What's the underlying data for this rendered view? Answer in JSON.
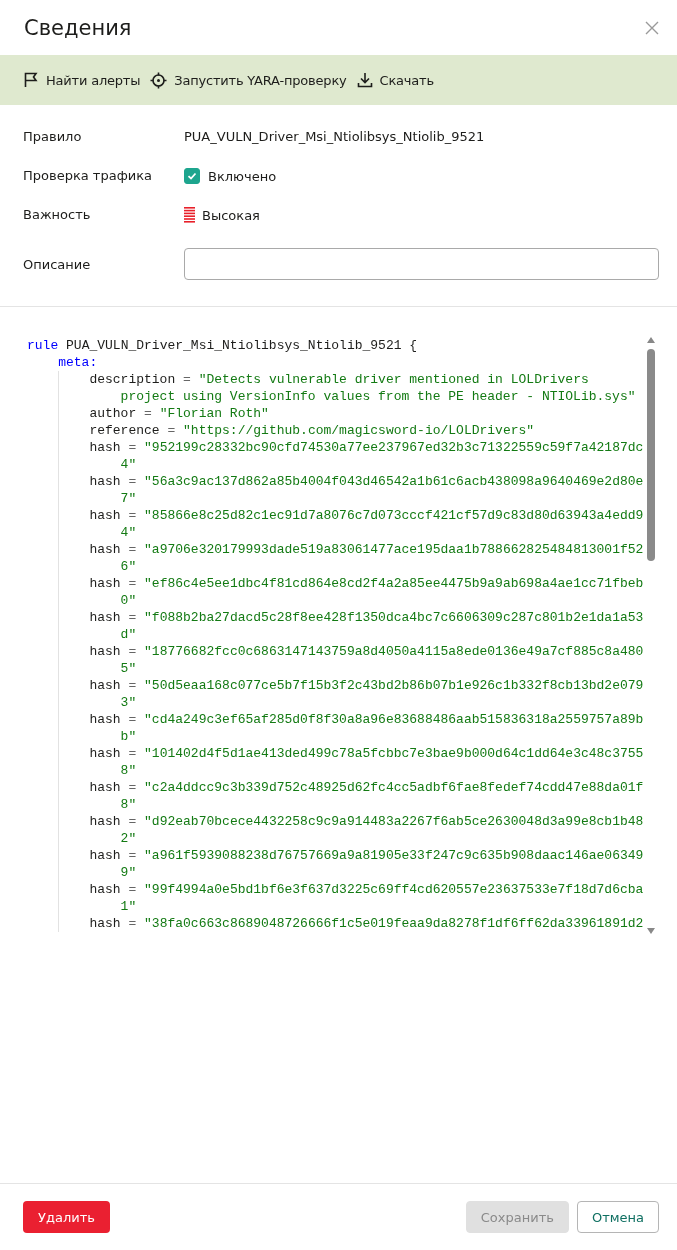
{
  "dialog": {
    "title": "Сведения"
  },
  "toolbar": [
    {
      "kind": "flag",
      "label": "Найти алерты"
    },
    {
      "kind": "target",
      "label": "Запустить YARA-проверку"
    },
    {
      "kind": "download",
      "label": "Скачать"
    }
  ],
  "fields": [
    {
      "kind": "text",
      "label": "Правило",
      "value": "PUA_VULN_Driver_Msi_Ntiolibsys_Ntiolib_9521"
    },
    {
      "kind": "checkbox",
      "label": "Проверка трафика",
      "value": "Включено",
      "checked": true
    },
    {
      "kind": "severity",
      "label": "Важность",
      "value": "Высокая"
    },
    {
      "kind": "input",
      "label": "Описание"
    }
  ],
  "code": {
    "rule": {
      "keyword": "rule",
      "name": "PUA_VULN_Driver_Msi_Ntiolibsys_Ntiolib_9521",
      "brace": "{"
    },
    "section": "meta:",
    "op": "=",
    "props": [
      {
        "key": "description",
        "value": "\"Detects vulnerable driver mentioned in LOLDrivers",
        "cont": "project using VersionInfo values from the PE header - NTIOLib.sys\""
      },
      {
        "key": "author",
        "value": "\"Florian Roth\""
      },
      {
        "key": "reference",
        "value": "\"https://github.com/magicsword-io/LOLDrivers\""
      },
      {
        "key": "hash",
        "value": "\"952199c28332bc90cfd74530a77ee237967ed32b3c71322559c59f7a42187dc",
        "cont": "4\""
      },
      {
        "key": "hash",
        "value": "\"56a3c9ac137d862a85b4004f043d46542a1b61c6acb438098a9640469e2d80e",
        "cont": "7\""
      },
      {
        "key": "hash",
        "value": "\"85866e8c25d82c1ec91d7a8076c7d073cccf421cf57d9c83d80d63943a4edd9",
        "cont": "4\""
      },
      {
        "key": "hash",
        "value": "\"a9706e320179993dade519a83061477ace195daa1b788662825484813001f52",
        "cont": "6\""
      },
      {
        "key": "hash",
        "value": "\"ef86c4e5ee1dbc4f81cd864e8cd2f4a2a85ee4475b9a9ab698a4ae1cc71fbeb",
        "cont": "0\""
      },
      {
        "key": "hash",
        "value": "\"f088b2ba27dacd5c28f8ee428f1350dca4bc7c6606309c287c801b2e1da1a53",
        "cont": "d\""
      },
      {
        "key": "hash",
        "value": "\"18776682fcc0c6863147143759a8d4050a4115a8ede0136e49a7cf885c8a480",
        "cont": "5\""
      },
      {
        "key": "hash",
        "value": "\"50d5eaa168c077ce5b7f15b3f2c43bd2b86b07b1e926c1b332f8cb13bd2e079",
        "cont": "3\""
      },
      {
        "key": "hash",
        "value": "\"cd4a249c3ef65af285d0f8f30a8a96e83688486aab515836318a2559757a89b",
        "cont": "b\""
      },
      {
        "key": "hash",
        "value": "\"101402d4f5d1ae413ded499c78a5fcbbc7e3bae9b000d64c1dd64e3c48c3755",
        "cont": "8\""
      },
      {
        "key": "hash",
        "value": "\"c2a4ddcc9c3b339d752c48925d62fc4cc5adbf6fae8fedef74cdd47e88da01f",
        "cont": "8\""
      },
      {
        "key": "hash",
        "value": "\"d92eab70bcece4432258c9c9a914483a2267f6ab5ce2630048d3a99e8cb1b48",
        "cont": "2\""
      },
      {
        "key": "hash",
        "value": "\"a961f5939088238d76757669a9a81905e33f247c9c635b908daac146ae06349",
        "cont": "9\""
      },
      {
        "key": "hash",
        "value": "\"99f4994a0e5bd1bf6e3f637d3225c69ff4cd620557e23637533e7f18d7d6cba",
        "cont": "1\""
      },
      {
        "key": "hash",
        "value": "\"38fa0c663c8689048726666f1c5e019feaa9da8278f1df6ff62da33961891d2"
      }
    ]
  },
  "buttons": [
    {
      "kind": "danger",
      "label": "Удалить",
      "disabled": false
    },
    {
      "kind": "primary",
      "label": "Сохранить",
      "disabled": true
    },
    {
      "kind": "secondary",
      "label": "Отмена",
      "disabled": false
    }
  ]
}
